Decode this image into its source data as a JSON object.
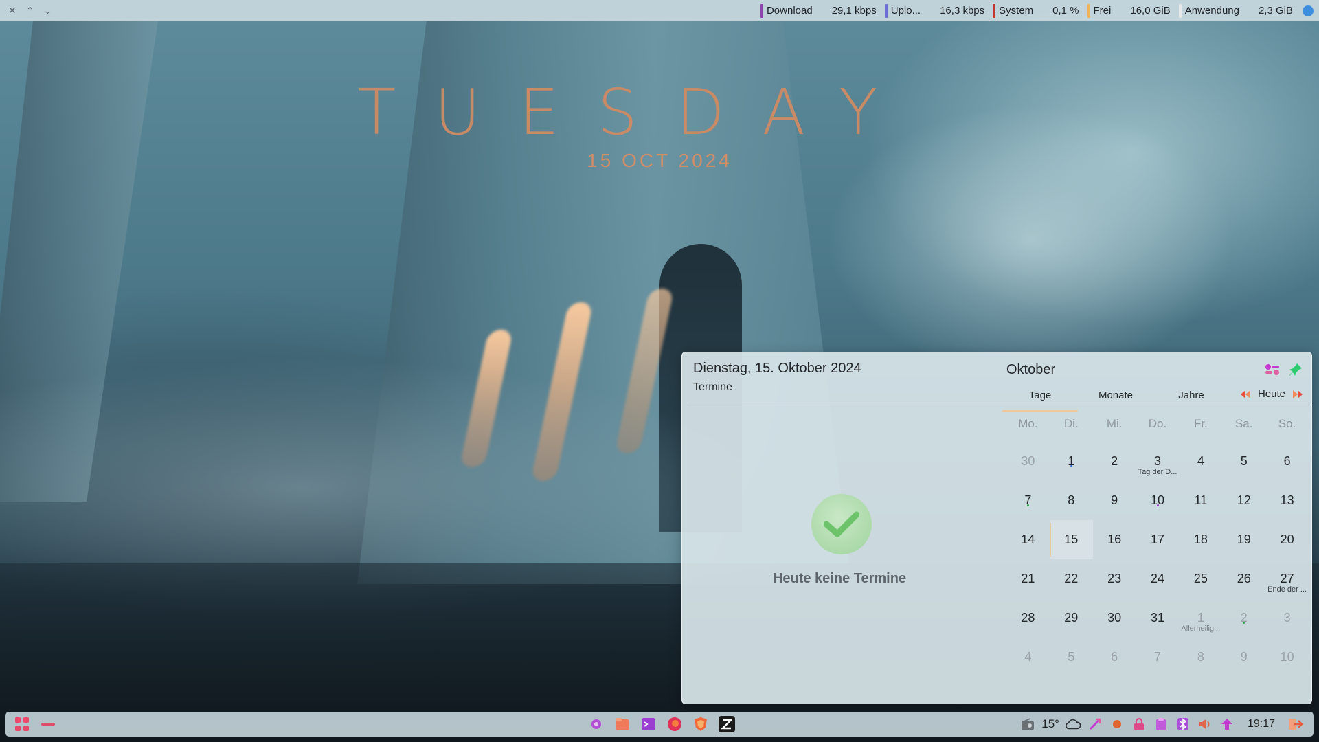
{
  "desktop": {
    "weekday_big": "TUESDAY",
    "date_big": "15 OCT 2024"
  },
  "top_panel": {
    "window_buttons": [
      "✕",
      "⌃",
      "⌄"
    ],
    "monitors": [
      {
        "label": "Download",
        "value": "29,1 kbps",
        "color": "#8e44ad"
      },
      {
        "label": "Uplo...",
        "value": "16,3 kbps",
        "color": "#6c6cd6"
      },
      {
        "label": "System",
        "value": "0,1 %",
        "color": "#c0392b"
      },
      {
        "label": "Frei",
        "value": "16,0 GiB",
        "color": "#f0b35a"
      },
      {
        "label": "Anwendung",
        "value": "2,3 GiB",
        "color": "#e8e8e8"
      }
    ]
  },
  "agenda": {
    "date": "Dienstag, 15. Oktober 2024",
    "subtitle": "Termine",
    "empty": "Heute keine Termine"
  },
  "calendar": {
    "month": "Oktober",
    "tabs": [
      "Tage",
      "Monate",
      "Jahre"
    ],
    "today": "Heute",
    "weekdays": [
      "Mo.",
      "Di.",
      "Mi.",
      "Do.",
      "Fr.",
      "Sa.",
      "So."
    ],
    "weeks": [
      [
        {
          "d": "30",
          "o": true
        },
        {
          "d": "1",
          "dot": "#2a5bd7"
        },
        {
          "d": "2"
        },
        {
          "d": "3",
          "sub": "Tag der D..."
        },
        {
          "d": "4"
        },
        {
          "d": "5"
        },
        {
          "d": "6"
        }
      ],
      [
        {
          "d": "7",
          "dot": "#2aa84a"
        },
        {
          "d": "8"
        },
        {
          "d": "9"
        },
        {
          "d": "10",
          "dot": "#9b3fc9"
        },
        {
          "d": "11"
        },
        {
          "d": "12"
        },
        {
          "d": "13"
        }
      ],
      [
        {
          "d": "14"
        },
        {
          "d": "15",
          "today": true
        },
        {
          "d": "16"
        },
        {
          "d": "17"
        },
        {
          "d": "18"
        },
        {
          "d": "19"
        },
        {
          "d": "20"
        }
      ],
      [
        {
          "d": "21"
        },
        {
          "d": "22"
        },
        {
          "d": "23"
        },
        {
          "d": "24"
        },
        {
          "d": "25"
        },
        {
          "d": "26"
        },
        {
          "d": "27",
          "sub": "Ende der ..."
        }
      ],
      [
        {
          "d": "28"
        },
        {
          "d": "29"
        },
        {
          "d": "30"
        },
        {
          "d": "31"
        },
        {
          "d": "1",
          "o": true,
          "sub": "Allerheilig..."
        },
        {
          "d": "2",
          "o": true,
          "dot": "#2aa84a"
        },
        {
          "d": "3",
          "o": true
        }
      ],
      [
        {
          "d": "4",
          "o": true
        },
        {
          "d": "5",
          "o": true
        },
        {
          "d": "6",
          "o": true
        },
        {
          "d": "7",
          "o": true
        },
        {
          "d": "8",
          "o": true
        },
        {
          "d": "9",
          "o": true
        },
        {
          "d": "10",
          "o": true
        }
      ]
    ]
  },
  "taskbar": {
    "weather_temp": "15°",
    "clock": "19:17"
  }
}
